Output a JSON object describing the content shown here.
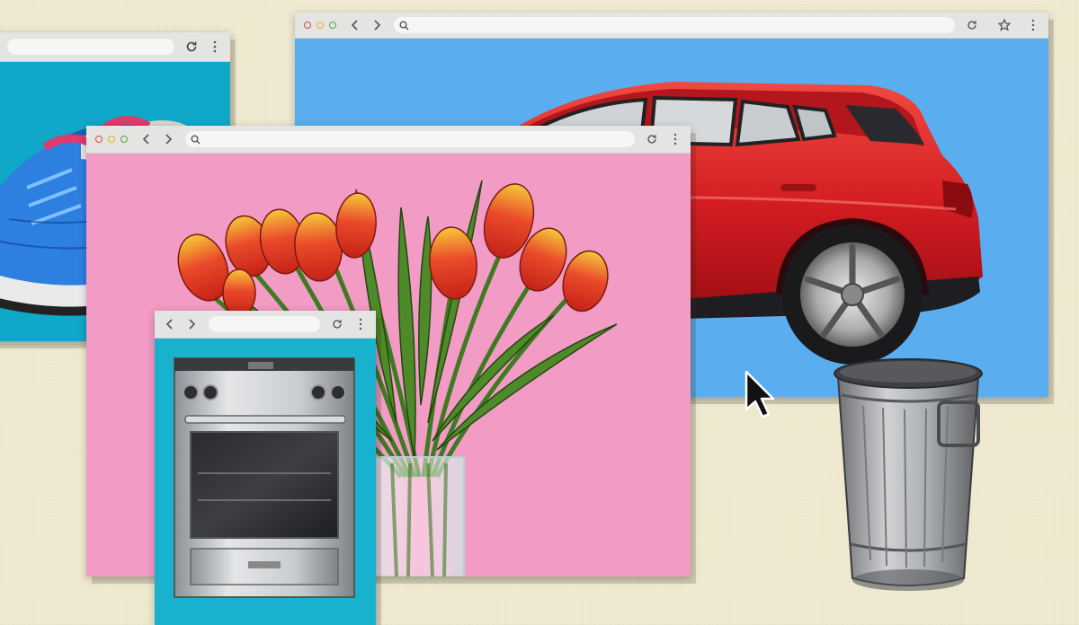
{
  "scene": {
    "background_color": "#f1ecd2",
    "windows": [
      {
        "id": "shoes-window",
        "content_color": "#0fa8c8",
        "subject": "sneakers"
      },
      {
        "id": "car-window",
        "content_color": "#5aaef0",
        "subject": "red-hatchback-car"
      },
      {
        "id": "tulips-window",
        "content_color": "#f29bc4",
        "subject": "tulips-in-vase"
      },
      {
        "id": "oven-window",
        "content_color": "#18b2cf",
        "subject": "stainless-range-oven"
      }
    ],
    "free_objects": [
      "mouse-cursor",
      "metal-trash-can"
    ]
  },
  "icons": {
    "back": "chevron-left-icon",
    "forward": "chevron-right-icon",
    "search": "search-icon",
    "reload": "reload-icon",
    "bookmark": "star-icon",
    "menu": "kebab-menu-icon"
  },
  "colors": {
    "chrome_bar": "#e4e4e2",
    "url_bar": "#f6f6f4",
    "traffic_red": "#e2463d",
    "traffic_yellow": "#e8b21f",
    "traffic_green": "#4aa83c",
    "car_red": "#d91f24",
    "tulip_red": "#e23a2a",
    "tulip_yellow": "#f4c531",
    "stem_green": "#4f8a2a"
  }
}
